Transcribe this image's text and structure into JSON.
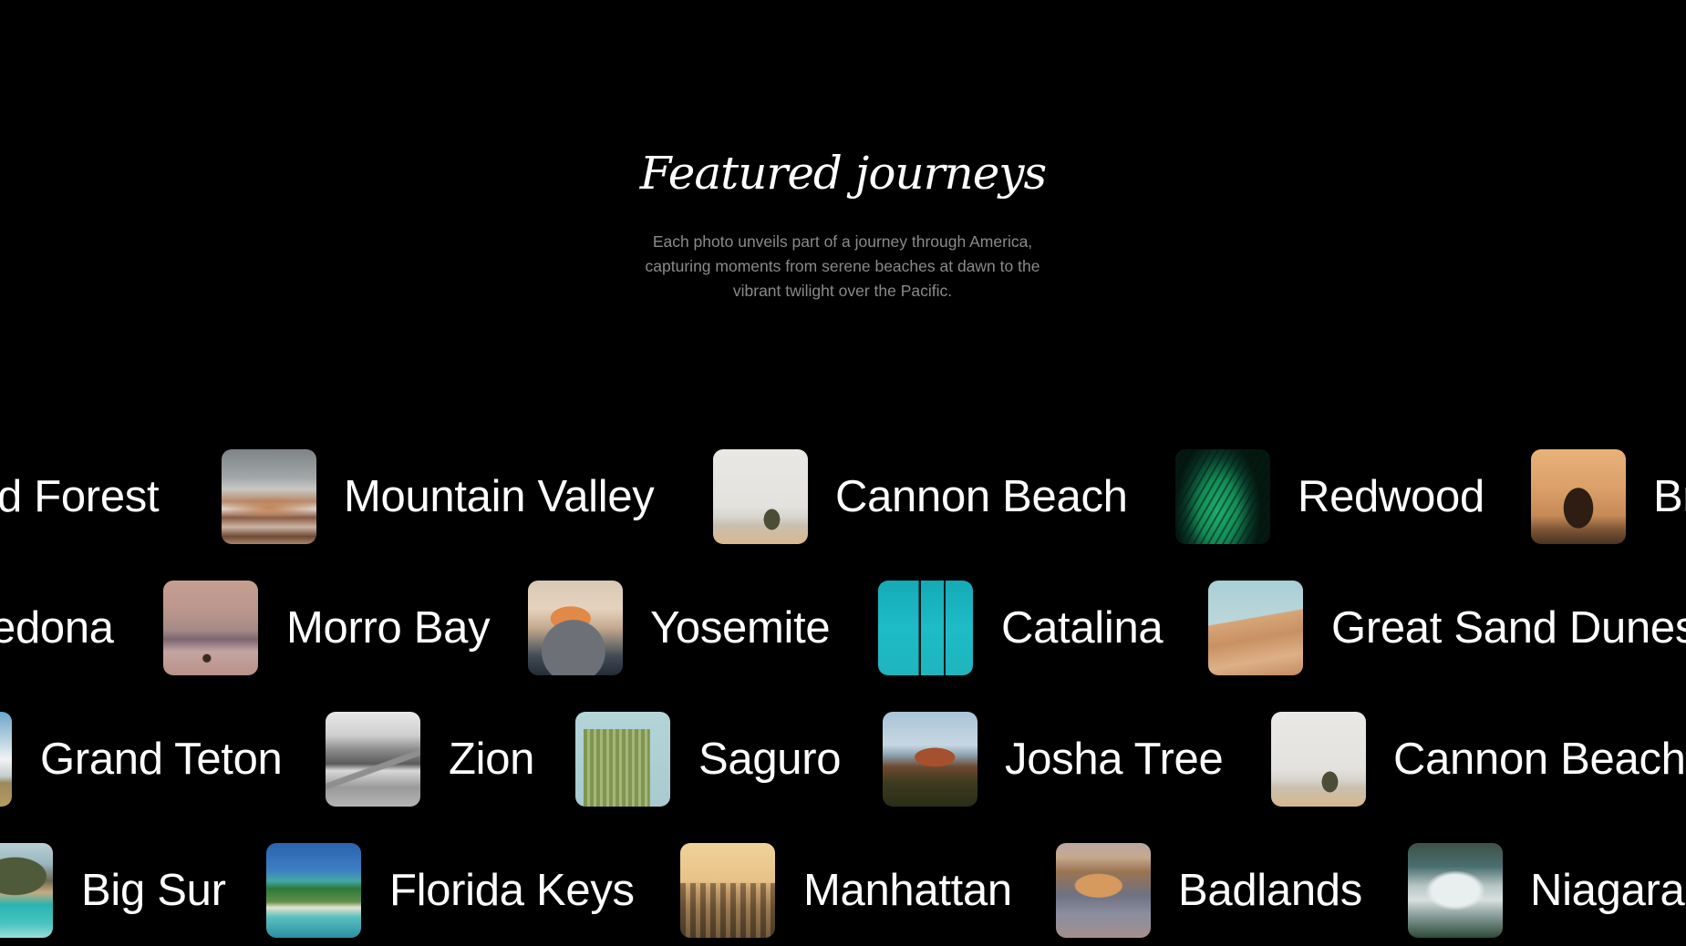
{
  "hero": {
    "title": "Featured journeys",
    "subtitle_lines": [
      "Each photo unveils part of a journey through America,",
      "capturing moments from serene beaches at dawn to the",
      "vibrant twilight over the Pacific."
    ]
  },
  "colors": {
    "background": "#000000",
    "title": "#ffffff",
    "subtitle": "#8a8a8a",
    "label": "#ffffff"
  },
  "rows": [
    {
      "items": [
        {
          "label": "Petrified Forest",
          "visible_label": "ed Forest",
          "photo": null
        },
        {
          "label": "Mountain Valley",
          "photo": "mountain-valley-photo"
        },
        {
          "label": "Cannon Beach",
          "photo": "cannon-beach-photo"
        },
        {
          "label": "Redwood",
          "photo": "redwood-fern-photo"
        },
        {
          "label": "Br",
          "photo": "haystack-rock-sunset-photo"
        }
      ]
    },
    {
      "items": [
        {
          "label": "Sedona",
          "visible_label": "edona",
          "photo": null
        },
        {
          "label": "Morro Bay",
          "photo": "morro-bay-bird-photo"
        },
        {
          "label": "Yosemite",
          "photo": "yosemite-half-dome-photo"
        },
        {
          "label": "Catalina",
          "photo": "catalina-palms-photo"
        },
        {
          "label": "Great Sand Dunes",
          "photo": "sand-dunes-photo"
        }
      ]
    },
    {
      "items": [
        {
          "label": "Grand Teton",
          "photo": "grand-teton-photo"
        },
        {
          "label": "Zion",
          "photo": "zion-road-photo"
        },
        {
          "label": "Saguro",
          "photo": "saguaro-cactus-photo"
        },
        {
          "label": "Josha Tree",
          "photo": "butte-rock-photo"
        },
        {
          "label": "Cannon Beach",
          "photo": "cannon-beach-photo"
        }
      ]
    },
    {
      "items": [
        {
          "label": "Big Sur",
          "photo": "big-sur-coast-photo"
        },
        {
          "label": "Florida Keys",
          "photo": "florida-keys-photo"
        },
        {
          "label": "Manhattan",
          "photo": "manhattan-skyline-photo"
        },
        {
          "label": "Badlands",
          "photo": "badlands-photo"
        },
        {
          "label": "Niagara",
          "photo": "niagara-falls-photo"
        }
      ]
    }
  ]
}
